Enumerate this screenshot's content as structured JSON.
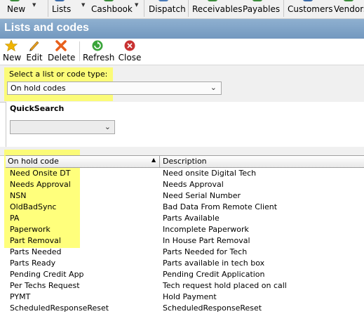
{
  "toolbar": {
    "items": [
      {
        "label": "New",
        "icon": "new-icon"
      },
      {
        "label": "Lists",
        "icon": "lists-icon"
      },
      {
        "label": "Cashbook",
        "icon": "cashbook-icon"
      },
      {
        "label": "Dispatch",
        "icon": "dispatch-icon"
      },
      {
        "label": "Receivables",
        "icon": "receivables-icon"
      },
      {
        "label": "Payables",
        "icon": "payables-icon"
      },
      {
        "label": "Customers",
        "icon": "customers-icon"
      },
      {
        "label": "Vendors",
        "icon": "vendors-icon"
      }
    ]
  },
  "window": {
    "title": "Lists and codes"
  },
  "actions": {
    "new": "New",
    "edit": "Edit",
    "delete": "Delete",
    "refresh": "Refresh",
    "close": "Close"
  },
  "selector": {
    "label": "Select a list or code type:",
    "value": "On hold codes"
  },
  "quicksearch": {
    "title": "QuickSearch",
    "value": ""
  },
  "grid": {
    "columns": [
      "On hold code",
      "Description"
    ],
    "rows": [
      [
        "Need Onsite DT",
        "Need onsite Digital Tech"
      ],
      [
        "Needs Approval",
        "Needs Approval"
      ],
      [
        "NSN",
        "Need Serial Number"
      ],
      [
        "OldBadSync",
        "Bad Data From Remote Client"
      ],
      [
        "PA",
        "Parts Available"
      ],
      [
        "Paperwork",
        "Incomplete Paperwork"
      ],
      [
        "Part Removal",
        "In House Part Removal"
      ],
      [
        "Parts Needed",
        "Parts Needed for Tech"
      ],
      [
        "Parts Ready",
        "Parts available in tech box"
      ],
      [
        "Pending Credit App",
        "Pending Credit Application"
      ],
      [
        "Per Techs Request",
        "Tech request hold placed on call"
      ],
      [
        "PYMT",
        "Hold Payment"
      ],
      [
        "ScheduledResponseReset",
        "ScheduledResponseReset"
      ]
    ]
  },
  "colors": {
    "title_bar": "#7b9ec4",
    "highlight": "#ffff50",
    "delete_icon": "#e8601c",
    "refresh_icon": "#3aa53a",
    "close_icon": "#c83232",
    "new_star": "#f0b400"
  }
}
